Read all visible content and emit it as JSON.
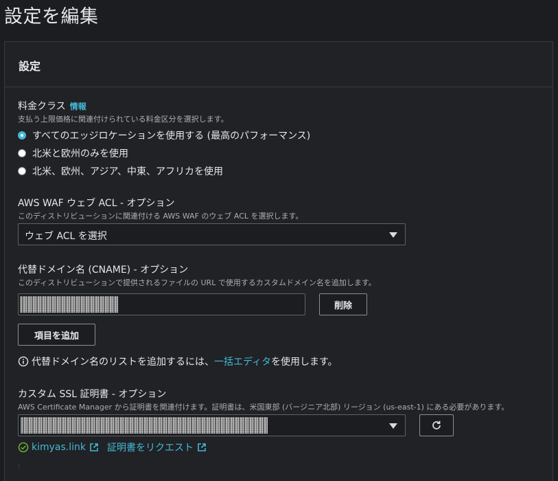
{
  "page": {
    "title": "設定を編集"
  },
  "panel": {
    "title": "設定"
  },
  "price_class": {
    "label": "料金クラス",
    "info": "情報",
    "description": "支払う上限価格に関連付けられている料金区分を選択します。",
    "options": [
      {
        "label": "すべてのエッジロケーションを使用する (最高のパフォーマンス)",
        "selected": true
      },
      {
        "label": "北米と欧州のみを使用",
        "selected": false
      },
      {
        "label": "北米、欧州、アジア、中東、アフリカを使用",
        "selected": false
      }
    ]
  },
  "waf": {
    "label": "AWS WAF ウェブ ACL - オプション",
    "description": "このディストリビューションに関連付ける AWS WAF のウェブ ACL を選択します。",
    "select_value": "ウェブ ACL を選択"
  },
  "cname": {
    "label": "代替ドメイン名 (CNAME) - オプション",
    "description": "このディストリビューションで提供されるファイルの URL で使用するカスタムドメイン名を追加します。",
    "remove_label": "削除",
    "add_label": "項目を追加",
    "info_prefix": "代替ドメイン名のリストを追加するには、",
    "info_link": "一括エディタ",
    "info_suffix": " を使用します。"
  },
  "ssl": {
    "label": "カスタム SSL 証明書 - オプション",
    "description": "AWS Certificate Manager から証明書を関連付けます。証明書は、米国東部 (バージニア北部) リージョン (us-east-1) にある必要があります。",
    "cert_link": "kimyas.link",
    "request_link": "証明書をリクエスト"
  },
  "colors": {
    "accent": "#44b9d6",
    "background": "#1b1d20",
    "panel": "#202225",
    "success": "#6aaf35"
  },
  "icons": [
    "info-icon",
    "refresh-icon",
    "external-link-icon",
    "check-circle-icon",
    "caret-down-icon"
  ]
}
